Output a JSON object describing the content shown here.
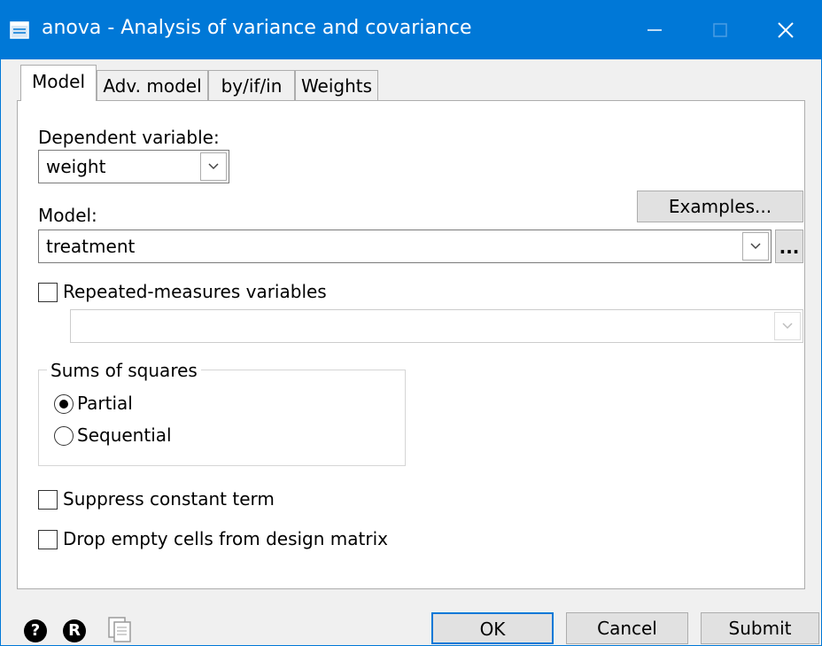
{
  "window": {
    "title": "anova - Analysis of variance and covariance",
    "icon": "dialog-app-icon"
  },
  "tabs": [
    {
      "label": "Model",
      "active": true
    },
    {
      "label": "Adv. model",
      "active": false
    },
    {
      "label": "by/if/in",
      "active": false
    },
    {
      "label": "Weights",
      "active": false
    }
  ],
  "dependent": {
    "label": "Dependent variable:",
    "value": "weight"
  },
  "model": {
    "label": "Model:",
    "value": "treatment",
    "examples_button": "Examples...",
    "browse_button": "..."
  },
  "repeated": {
    "label": "Repeated-measures variables",
    "checked": false,
    "value": ""
  },
  "sums_of_squares": {
    "legend": "Sums of squares",
    "options": [
      {
        "label": "Partial",
        "selected": true
      },
      {
        "label": "Sequential",
        "selected": false
      }
    ]
  },
  "options": {
    "suppress_constant": {
      "label": "Suppress constant term",
      "checked": false
    },
    "drop_empty": {
      "label": "Drop empty cells from design matrix",
      "checked": false
    }
  },
  "footer": {
    "help_icon": "?",
    "reset_icon": "R",
    "ok": "OK",
    "cancel": "Cancel",
    "submit": "Submit"
  },
  "colors": {
    "titlebar": "#0078d7",
    "accent": "#0078d7"
  }
}
